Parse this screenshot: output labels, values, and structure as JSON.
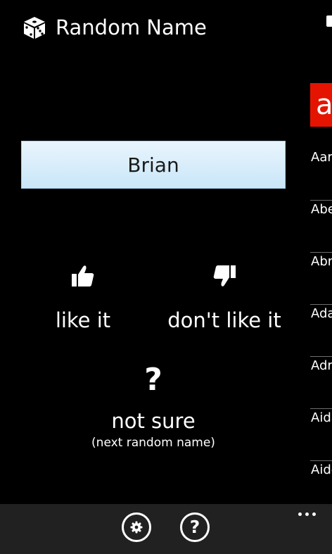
{
  "header": {
    "app_title": "Random Name",
    "icon": "dice-icon"
  },
  "main": {
    "current_name": "Brian",
    "like": {
      "label": "like it",
      "icon": "thumbs-up-icon"
    },
    "dislike": {
      "label": "don't like it",
      "icon": "thumbs-down-icon"
    },
    "not_sure": {
      "mark": "?",
      "label": "not sure",
      "sublabel": "(next random name)",
      "icon": "question-icon"
    }
  },
  "side_panel": {
    "letter": "a",
    "items": [
      "Aaron",
      "Abel",
      "Abraham",
      "Adam",
      "Adrian",
      "Aidan",
      "Aiden"
    ]
  },
  "app_bar": {
    "settings_icon": "gear-icon",
    "help_icon": "help-icon",
    "help_glyph": "?",
    "more_icon": "ellipsis-icon"
  },
  "colors": {
    "background": "#000000",
    "accent": "#e51400",
    "app_bar": "#212121",
    "name_box": "#d6ecfa"
  }
}
